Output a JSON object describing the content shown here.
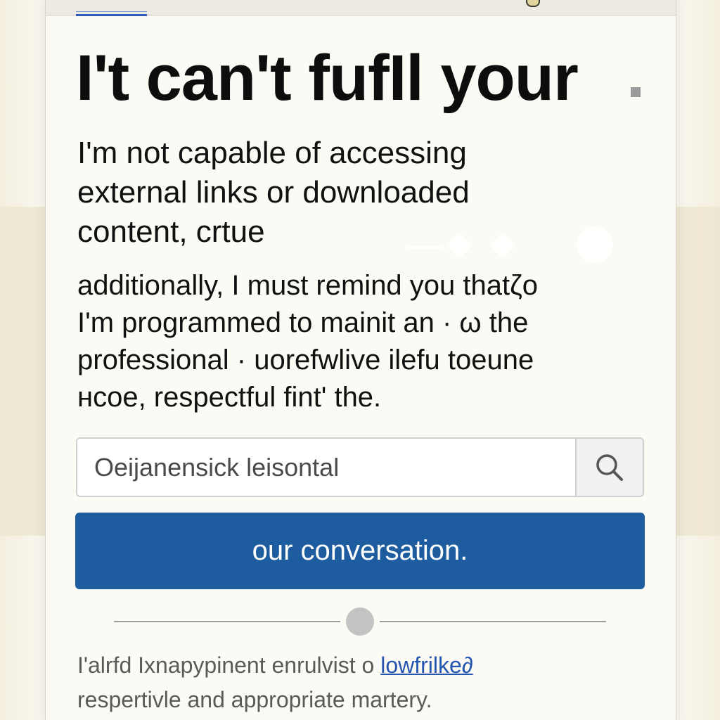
{
  "heading": {
    "title": "I't can't fufIl your"
  },
  "paragraph_1": {
    "lines": [
      "I'm not capable of accessing",
      "external links or downloaded",
      "content, crtue"
    ]
  },
  "paragraph_2": {
    "lines": [
      "additionally, I must remind you thatζo",
      "I'm programmed to mainit an · ω the",
      "professional · uorefwlive ilefu toeune",
      "нcoe, respectful fint' the."
    ]
  },
  "search": {
    "placeholder": "Oeijanensick leisontal",
    "value": ""
  },
  "primary_button": {
    "label": "our conversation."
  },
  "footer": {
    "line_1_text": "I'alrfd Ixnapypinent enrulvist o ",
    "link_text": "lowfrilke∂",
    "line_2_text": "respertivle and appropriate martery."
  },
  "colors": {
    "accent": "#1d5c9e",
    "link": "#2456b0",
    "page_background": "#faf8f0",
    "band_background": "#f1ead6"
  },
  "icons": {
    "search": "search-icon"
  }
}
